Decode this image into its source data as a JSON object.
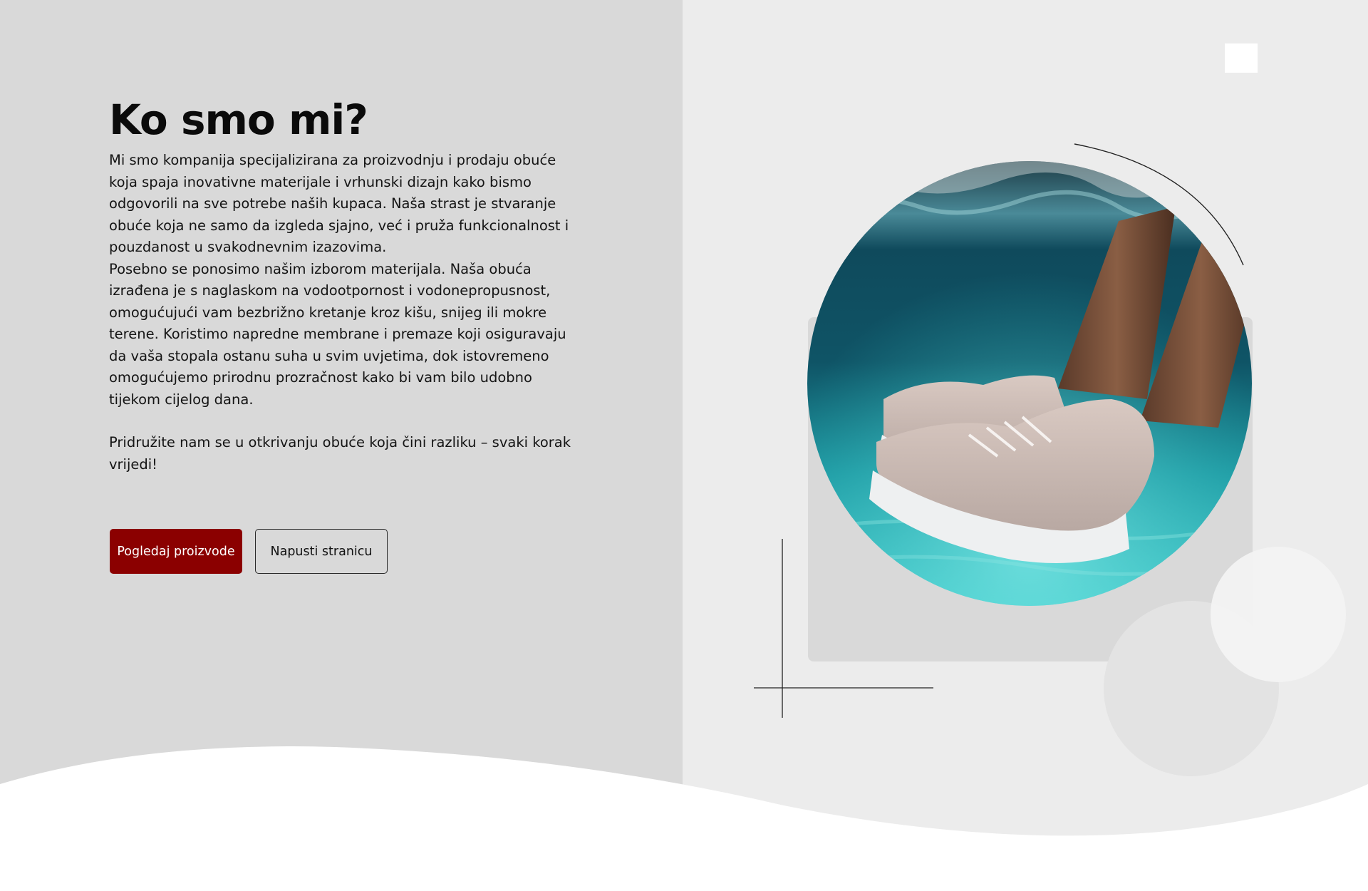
{
  "section": {
    "title": "Ko smo mi?",
    "paragraphs": [
      "Mi smo kompanija specijalizirana za proizvodnju i prodaju obuće koja spaja inovativne materijale i vrhunski dizajn kako bismo odgovorili na sve potrebe naših kupaca. Naša strast je stvaranje obuće koja ne samo da izgleda sjajno, već i pruža funkcionalnost i pouzdanost u svakodnevnim izazovima.",
      "Posebno se ponosimo našim izborom materijala. Naša obuća izrađena je s naglaskom na vodootpornost i vodonepropusnost, omogućujući vam bezbrižno kretanje kroz kišu, snijeg ili mokre terene. Koristimo napredne membrane i premaze koji osiguravaju da vaša stopala ostanu suha u svim uvjetima, dok istovremeno omogućujemo prirodnu prozračnost kako bi vam bilo udobno tijekom cijelog dana.",
      "Pridružite nam se u otkrivanju obuće koja čini razliku – svaki korak vrijedi!"
    ]
  },
  "buttons": {
    "primary_label": "Pogledaj proizvode",
    "secondary_label": "Napusti stranicu"
  },
  "colors": {
    "primary_button": "#8b0000",
    "left_panel": "#d9d9d9",
    "right_panel": "#ececec"
  },
  "image": {
    "icon": "shoe-underwater-photo"
  }
}
